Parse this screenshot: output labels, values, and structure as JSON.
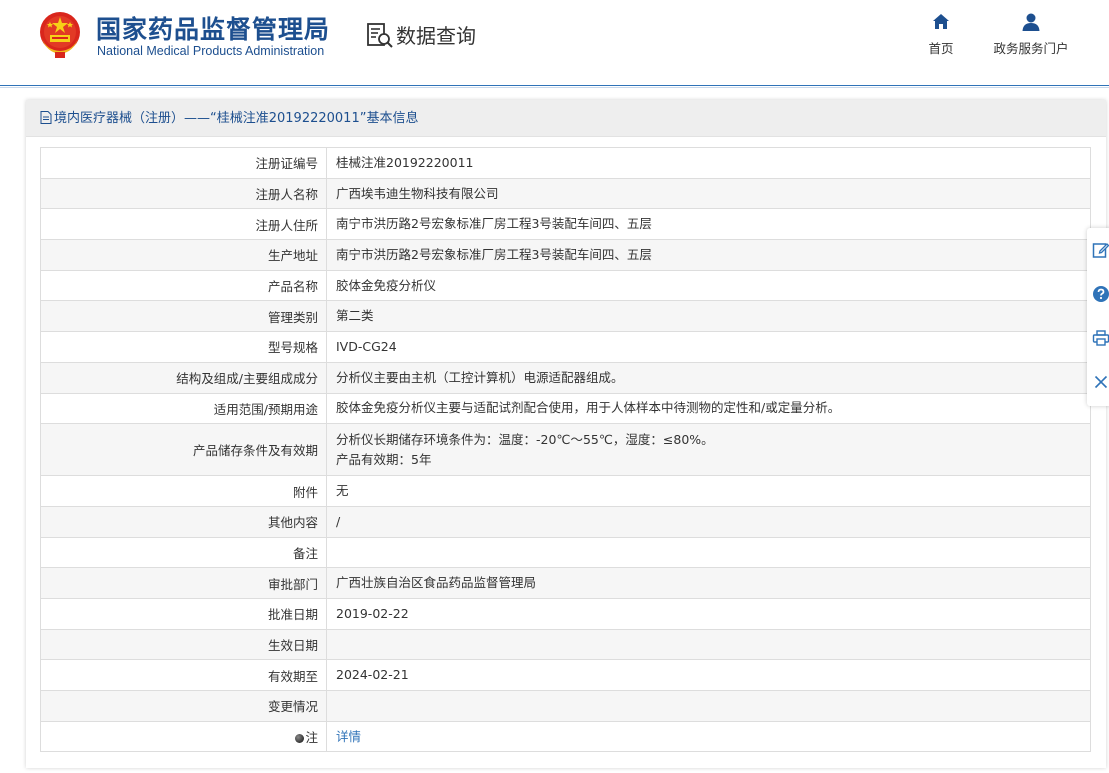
{
  "header": {
    "org_name_cn": "国家药品监督管理局",
    "org_name_en": "National Medical Products Administration",
    "section_title": "数据查询",
    "nav": [
      {
        "label": "首页",
        "icon": "home-icon"
      },
      {
        "label": "政务服务门户",
        "icon": "user-icon"
      }
    ]
  },
  "panel": {
    "title": "境内医疗器械（注册）——“桂械注准20192220011”基本信息"
  },
  "rows": [
    {
      "label": "注册证编号",
      "value": "桂械注准20192220011"
    },
    {
      "label": "注册人名称",
      "value": "广西埃韦迪生物科技有限公司"
    },
    {
      "label": "注册人住所",
      "value": "南宁市洪历路2号宏象标准厂房工程3号装配车间四、五层"
    },
    {
      "label": "生产地址",
      "value": "南宁市洪历路2号宏象标准厂房工程3号装配车间四、五层"
    },
    {
      "label": "产品名称",
      "value": "胶体金免疫分析仪"
    },
    {
      "label": "管理类别",
      "value": "第二类"
    },
    {
      "label": "型号规格",
      "value": "IVD-CG24"
    },
    {
      "label": "结构及组成/主要组成成分",
      "value": "分析仪主要由主机（工控计算机）电源适配器组成。"
    },
    {
      "label": "适用范围/预期用途",
      "value": "胶体金免疫分析仪主要与适配试剂配合使用，用于人体样本中待测物的定性和/或定量分析。"
    },
    {
      "label": "产品储存条件及有效期",
      "value_line1": "分析仪长期储存环境条件为：温度：-20℃～55℃，湿度：≤80%。",
      "value_line2": "产品有效期：5年"
    },
    {
      "label": "附件",
      "value": "无"
    },
    {
      "label": "其他内容",
      "value": "/"
    },
    {
      "label": "备注",
      "value": ""
    },
    {
      "label": "审批部门",
      "value": "广西壮族自治区食品药品监督管理局"
    },
    {
      "label": "批准日期",
      "value": "2019-02-22"
    },
    {
      "label": "生效日期",
      "value": ""
    },
    {
      "label": "有效期至",
      "value": "2024-02-21"
    },
    {
      "label": "变更情况",
      "value": ""
    },
    {
      "label": "注",
      "value": "详情"
    }
  ],
  "side_tools": [
    "edit-icon",
    "help-icon",
    "print-icon",
    "close-icon"
  ],
  "colors": {
    "brand_blue": "#1d4f8f",
    "link_blue": "#2f73b8",
    "row_alt": "#f6f6f6",
    "border": "#dddddd"
  }
}
